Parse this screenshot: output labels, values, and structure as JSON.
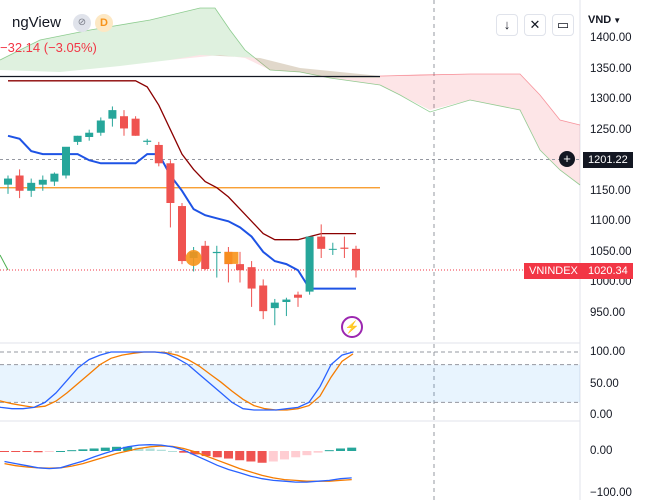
{
  "legend": {
    "title": "ngView",
    "badge_grey": "⊘",
    "badge_orange": "D",
    "change": "−32.14 (−3.05%)"
  },
  "toolbar": {
    "arrow_icon": "arrow-down-icon",
    "expand_icon": "expand-icon",
    "fullscreen_icon": "fullscreen-icon",
    "currency": "VND"
  },
  "crosshair_label": "1201.22",
  "last_price": {
    "symbol": "VNINDEX",
    "value": "1020.34",
    "color": "#f23645"
  },
  "colors": {
    "up": "#26a69a",
    "down": "#ef5350",
    "kijun": "#8b0000",
    "tenkan": "#1e53e5",
    "orange": "#f7931a",
    "k_line": "#2962ff",
    "d_line": "#f57c00"
  },
  "chart_data": [
    {
      "type": "candlestick",
      "price_axis": [
        "1400.00",
        "1350.00",
        "1300.00",
        "1250.00",
        "1200.00",
        "1150.00",
        "1100.00",
        "1050.00",
        "1000.00",
        "950.00"
      ],
      "ylim": [
        925,
        1410
      ],
      "candles": [
        {
          "o": 1160,
          "h": 1175,
          "l": 1145,
          "c": 1170
        },
        {
          "o": 1175,
          "h": 1185,
          "l": 1138,
          "c": 1150
        },
        {
          "o": 1150,
          "h": 1170,
          "l": 1140,
          "c": 1163
        },
        {
          "o": 1160,
          "h": 1175,
          "l": 1150,
          "c": 1168
        },
        {
          "o": 1165,
          "h": 1180,
          "l": 1158,
          "c": 1178
        },
        {
          "o": 1175,
          "h": 1220,
          "l": 1170,
          "c": 1222
        },
        {
          "o": 1230,
          "h": 1240,
          "l": 1225,
          "c": 1240
        },
        {
          "o": 1238,
          "h": 1250,
          "l": 1232,
          "c": 1245
        },
        {
          "o": 1245,
          "h": 1270,
          "l": 1240,
          "c": 1265
        },
        {
          "o": 1268,
          "h": 1288,
          "l": 1255,
          "c": 1282
        },
        {
          "o": 1272,
          "h": 1282,
          "l": 1240,
          "c": 1252
        },
        {
          "o": 1268,
          "h": 1272,
          "l": 1240,
          "c": 1240
        },
        {
          "o": 1230,
          "h": 1235,
          "l": 1225,
          "c": 1232
        },
        {
          "o": 1225,
          "h": 1230,
          "l": 1190,
          "c": 1195
        },
        {
          "o": 1195,
          "h": 1200,
          "l": 1090,
          "c": 1130
        },
        {
          "o": 1125,
          "h": 1130,
          "l": 1030,
          "c": 1035
        },
        {
          "o": 1040,
          "h": 1058,
          "l": 1018,
          "c": 1050
        },
        {
          "o": 1060,
          "h": 1068,
          "l": 1020,
          "c": 1022
        },
        {
          "o": 1048,
          "h": 1060,
          "l": 1008,
          "c": 1050
        },
        {
          "o": 1050,
          "h": 1058,
          "l": 1000,
          "c": 1030
        },
        {
          "o": 1030,
          "h": 1050,
          "l": 1000,
          "c": 1020
        },
        {
          "o": 1025,
          "h": 1035,
          "l": 960,
          "c": 990
        },
        {
          "o": 995,
          "h": 1005,
          "l": 940,
          "c": 953
        },
        {
          "o": 958,
          "h": 973,
          "l": 930,
          "c": 967
        },
        {
          "o": 968,
          "h": 975,
          "l": 945,
          "c": 972
        },
        {
          "o": 980,
          "h": 985,
          "l": 960,
          "c": 975
        },
        {
          "o": 985,
          "h": 1075,
          "l": 980,
          "c": 1075
        },
        {
          "o": 1075,
          "h": 1095,
          "l": 1040,
          "c": 1055
        },
        {
          "o": 1055,
          "h": 1065,
          "l": 1045,
          "c": 1055
        },
        {
          "o": 1057,
          "h": 1075,
          "l": 1040,
          "c": 1055
        },
        {
          "o": 1055,
          "h": 1060,
          "l": 1008,
          "c": 1020
        }
      ],
      "lines": {
        "kijun": [
          1330,
          1330,
          1330,
          1330,
          1330,
          1330,
          1330,
          1330,
          1330,
          1330,
          1330,
          1330,
          1320,
          1290,
          1250,
          1210,
          1185,
          1165,
          1155,
          1140,
          1120,
          1100,
          1080,
          1070,
          1070,
          1070,
          1075,
          1080,
          1080,
          1080,
          1080
        ],
        "tenkan": [
          1240,
          1235,
          1215,
          1210,
          1210,
          1210,
          1210,
          1200,
          1195,
          1195,
          1195,
          1195,
          1210,
          1210,
          1175,
          1150,
          1120,
          1110,
          1105,
          1100,
          1090,
          1075,
          1050,
          1035,
          1030,
          1020,
          990,
          990,
          990,
          990,
          990
        ],
        "black_level": 1337,
        "orange_level": 1155,
        "dotted_last": 1020.34,
        "dotted_crosshair": 1201.22
      }
    },
    {
      "type": "line",
      "name": "stochastic",
      "axis": [
        "100.00",
        "50.00",
        "0.00"
      ],
      "ylim": [
        0,
        100
      ],
      "band": [
        20,
        80
      ],
      "k": [
        15,
        12,
        10,
        10,
        12,
        20,
        35,
        55,
        75,
        88,
        95,
        100,
        100,
        100,
        100,
        100,
        98,
        90,
        80,
        65,
        50,
        35,
        20,
        10,
        8,
        8,
        8,
        10,
        12,
        20,
        45,
        80,
        95,
        100
      ],
      "d": [
        25,
        22,
        18,
        15,
        12,
        14,
        22,
        35,
        50,
        65,
        80,
        90,
        95,
        98,
        100,
        100,
        99,
        95,
        88,
        78,
        65,
        52,
        38,
        25,
        15,
        10,
        8,
        8,
        10,
        15,
        30,
        60,
        85,
        97
      ]
    },
    {
      "type": "bar",
      "name": "macd",
      "axis": [
        "0.00",
        "−100.00"
      ],
      "ylim": [
        -110,
        50
      ],
      "histogram": [
        -1,
        -1,
        -2,
        -3,
        -2,
        0,
        2,
        4,
        6,
        8,
        10,
        10,
        8,
        6,
        3,
        0,
        -4,
        -8,
        -12,
        -15,
        -18,
        -22,
        -25,
        -28,
        -25,
        -20,
        -15,
        -10,
        -4,
        2,
        6,
        8
      ],
      "macd": [
        -25,
        -30,
        -35,
        -40,
        -42,
        -40,
        -32,
        -24,
        -14,
        -5,
        3,
        10,
        14,
        15,
        14,
        10,
        2,
        -10,
        -22,
        -34,
        -44,
        -52,
        -60,
        -66,
        -70,
        -72,
        -74,
        -74,
        -72,
        -70,
        -66,
        -64
      ],
      "signal": [
        -30,
        -35,
        -38,
        -40,
        -41,
        -40,
        -36,
        -30,
        -22,
        -14,
        -6,
        0,
        6,
        10,
        12,
        11,
        6,
        -2,
        -12,
        -22,
        -32,
        -42,
        -50,
        -58,
        -64,
        -68,
        -70,
        -72,
        -72,
        -72,
        -70,
        -68
      ]
    }
  ]
}
